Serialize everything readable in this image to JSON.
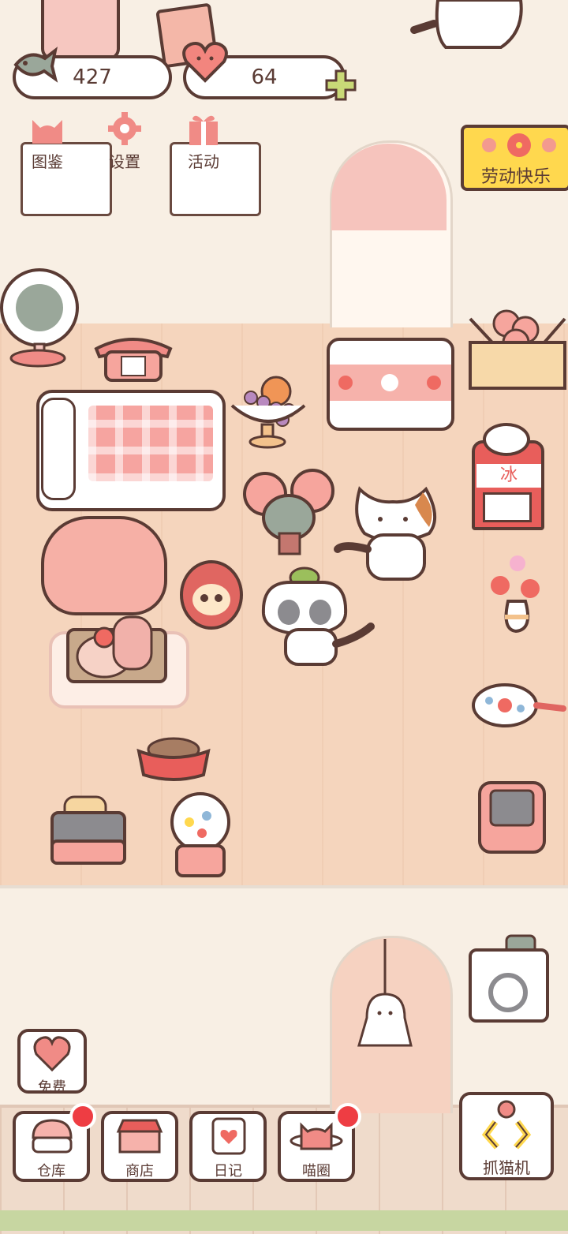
{
  "hud": {
    "fish_count": "427",
    "heart_count": "64"
  },
  "menu": [
    {
      "label": "图鉴",
      "icon": "cat-head-icon"
    },
    {
      "label": "设置",
      "icon": "gear-icon"
    },
    {
      "label": "活动",
      "icon": "gift-icon"
    }
  ],
  "event_banner": {
    "label": "劳动快乐"
  },
  "free_button": {
    "label": "免费"
  },
  "bottom_nav": [
    {
      "label": "仓库",
      "badge": true
    },
    {
      "label": "商店",
      "badge": false
    },
    {
      "label": "日记",
      "badge": false
    },
    {
      "label": "喵圈",
      "badge": true
    }
  ],
  "claw_machine": {
    "label": "抓猫机"
  },
  "shaved_ice_sign": "冰",
  "colors": {
    "accent_pink": "#f08b86",
    "outline": "#5a3b34",
    "floor": "#f5d5bd",
    "banner_yellow": "#ffd84e",
    "badge_red": "#ee3d43"
  }
}
